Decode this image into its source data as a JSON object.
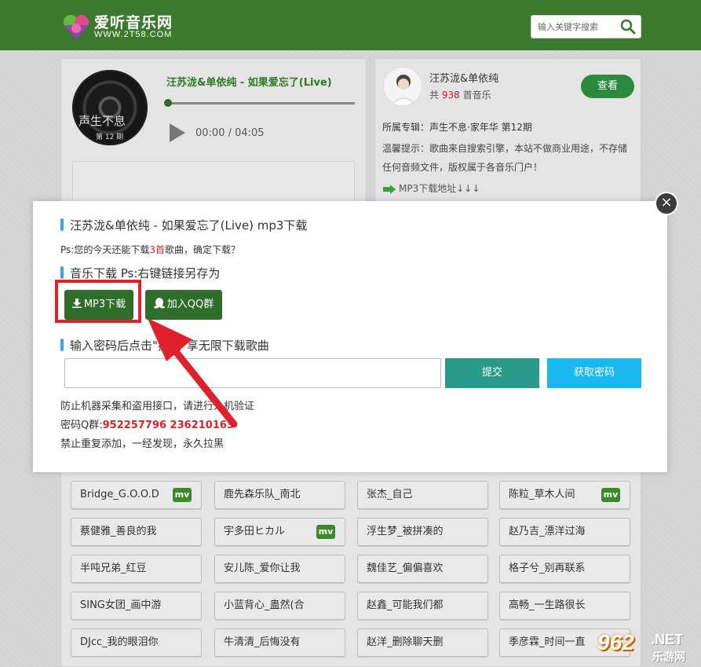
{
  "header": {
    "site_name": "爱听音乐网",
    "site_url": "WWW.2T58.COM",
    "search_placeholder": "输入关键字搜索",
    "colors": {
      "header_bg": "#3b7a2c"
    }
  },
  "player": {
    "song_title": "汪苏泷&单依纯 - 如果爱忘了(Live)",
    "album_art_text": "声生不息",
    "album_art_sub": "第 12 期",
    "time": "00:00 / 04:05",
    "progress": 0
  },
  "artist_card": {
    "name": "汪苏泷&单依纯",
    "count_prefix": "共",
    "count": "938",
    "count_suffix": "首音乐",
    "view_button": "查看",
    "album_line": "所属专辑：声生不息·家年华 第12期",
    "notice": "温馨提示：歌曲来自搜索引擎，本站不做商业用途，不存储任何音频文件，版权属于各音乐门户！",
    "mp3_link": "MP3下载地址↓↓↓"
  },
  "modal": {
    "title": "汪苏泷&单依纯 - 如果爱忘了(Live) mp3下载",
    "ps_prefix": "Ps:您的今天还能下载",
    "ps_count": "3首",
    "ps_suffix": "歌曲，确定下载？",
    "download_title": "音乐下载 Ps:右键链接另存为",
    "mp3_button": "MP3下载",
    "qq_button": "加入QQ群",
    "password_title": "输入密码后点击\"提交\"享无限下载歌曲",
    "password_value": "",
    "submit_button": "提交",
    "get_password_button": "获取密码",
    "note1": "防止机器采集和盗用接口，请进行人机验证",
    "note2_prefix": "密码Q群:",
    "note2_groups": "952257796 236210163",
    "note3": "禁止重复添加，一经发现，永久拉黑",
    "close": "×"
  },
  "songs": [
    {
      "name": "Bridge_G.O.O.D",
      "mv": "mv"
    },
    {
      "name": "鹿先森乐队_南北",
      "mv": ""
    },
    {
      "name": "张杰_自己",
      "mv": ""
    },
    {
      "name": "陈粒_草木人间",
      "mv": "mv"
    },
    {
      "name": "蔡健雅_善良的我",
      "mv": ""
    },
    {
      "name": "宇多田ヒカル",
      "mv": "mv"
    },
    {
      "name": "浮生梦_被拼凑的",
      "mv": ""
    },
    {
      "name": "赵乃吉_漂洋过海",
      "mv": ""
    },
    {
      "name": "半吨兄弟_红豆",
      "mv": ""
    },
    {
      "name": "安儿陈_爱你让我",
      "mv": ""
    },
    {
      "name": "魏佳艺_偏偏喜欢",
      "mv": ""
    },
    {
      "name": "格子兮_别再联系",
      "mv": ""
    },
    {
      "name": "SING女团_画中游",
      "mv": ""
    },
    {
      "name": "小蓝背心_蛊然(合",
      "mv": ""
    },
    {
      "name": "赵鑫_可能我们都",
      "mv": ""
    },
    {
      "name": "高畅_一生路很长",
      "mv": ""
    },
    {
      "name": "DJcc_我的眼泪你",
      "mv": ""
    },
    {
      "name": "牛清清_后悔没有",
      "mv": ""
    },
    {
      "name": "赵洋_删除聊天删",
      "mv": ""
    },
    {
      "name": "季彦霖_时间一直",
      "mv": ""
    }
  ],
  "watermark": {
    "num": "962",
    "net": ".NET",
    "sub": "乐游网"
  }
}
